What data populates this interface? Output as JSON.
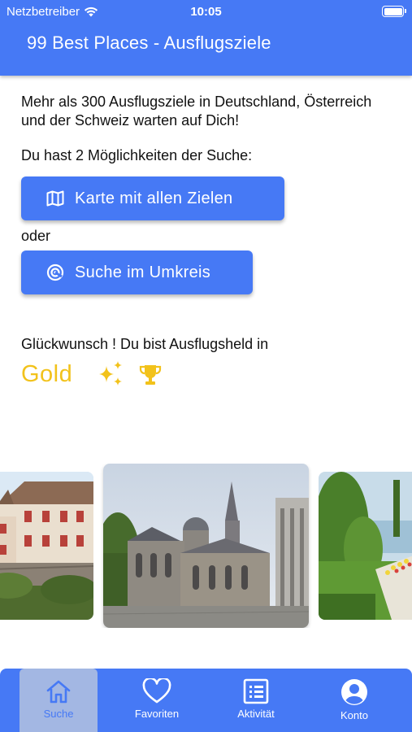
{
  "status_bar": {
    "carrier": "Netzbetreiber",
    "time": "10:05"
  },
  "app_bar": {
    "title": "99 Best Places - Ausflugsziele"
  },
  "main": {
    "intro": "Mehr als 300 Ausflugsziele in Deutschland, Österreich und der Schweiz warten auf Dich!",
    "choices_text": "Du hast 2 Möglichkeiten der Suche:",
    "map_button_label": "Karte mit allen Zielen",
    "or_text": "oder",
    "radius_button_label": "Suche im Umkreis",
    "congrats_text": "Glückwunsch ! Du bist Ausflugsheld in",
    "level": "Gold"
  },
  "bottom_nav": {
    "items": [
      {
        "label": "Suche",
        "icon": "home-icon",
        "active": true
      },
      {
        "label": "Favoriten",
        "icon": "heart-icon",
        "active": false
      },
      {
        "label": "Aktivität",
        "icon": "list-icon",
        "active": false
      },
      {
        "label": "Konto",
        "icon": "account-icon",
        "active": false
      }
    ]
  },
  "colors": {
    "primary": "#4679f5",
    "gold": "#f2c21b",
    "active_tab_bg": "#a3b7e3"
  }
}
